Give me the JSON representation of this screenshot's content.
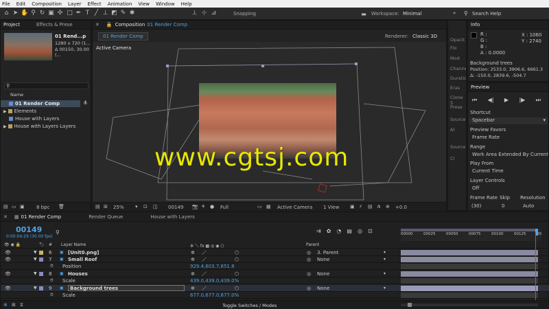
{
  "menu": [
    "File",
    "Edit",
    "Composition",
    "Layer",
    "Effect",
    "Animation",
    "View",
    "Window",
    "Help"
  ],
  "toolbar": {
    "snapping": "Snapping",
    "workspace_label": "Workspace:",
    "workspace_value": "Minimal",
    "search_placeholder": "Search Help"
  },
  "project": {
    "tabs": [
      "Project",
      "Effects & Prese"
    ],
    "thumb_title": "01 Rend...p",
    "thumb_size": "1280 x 720 (1...",
    "thumb_time": "Δ 00150, 30.00 (...",
    "col_name": "Name",
    "items": [
      "01 Render Comp",
      "Elements",
      "House with Layers",
      "House with Layers Layers"
    ],
    "bpc": "8 bpc"
  },
  "composition": {
    "tab_label": "Composition",
    "tab_name": "01 Render Comp",
    "subtab": "01 Render Comp",
    "renderer_label": "Renderer:",
    "renderer_value": "Classic 3D",
    "active_camera": "Active Camera",
    "zoom": "25%",
    "timecode": "00149",
    "resolution": "Full",
    "view_camera": "Active Camera",
    "view_count": "1 View",
    "exposure": "+0.0"
  },
  "middle_strip": [
    "Opacit",
    "Flo",
    "Mod",
    "Channe",
    "Duratio",
    "Eras",
    "Clone S",
    "Prese",
    "Source",
    "Al",
    "Source",
    "Cl"
  ],
  "info": {
    "title": "Info",
    "r": "R :",
    "g": "G :",
    "b": "B :",
    "a": "A : 0.0000",
    "x": "X : 1060",
    "y": "Y : 2740",
    "layer": "Background trees",
    "position": "Position: 2533.0, 3906.6, 6661.3",
    "delta": "Δ: -150.0, 2839.6, -504.7"
  },
  "preview": {
    "title": "Preview",
    "shortcut_label": "Shortcut",
    "shortcut_value": "Spacebar",
    "favors_label": "Preview Favors",
    "favors_value": "Frame Rate",
    "range_label": "Range",
    "range_value": "Work Area Extended By Current Ti",
    "playfrom_label": "Play From",
    "playfrom_value": "Current Time",
    "layer_controls_label": "Layer Controls",
    "layer_controls_value": "Off",
    "framerate_label": "Frame Rate",
    "skip_label": "Skip",
    "resolution_label": "Resolution",
    "framerate_value": "(30)",
    "skip_value": "0",
    "resolution_value": "Auto"
  },
  "timeline": {
    "tabs": [
      "01 Render Comp",
      "Render Queue",
      "House with Layers"
    ],
    "timecode": "00149",
    "fps": "0:00:04:29 (30.00 fps)",
    "col_layer_name": "Layer Name",
    "col_parent": "Parent",
    "ruler": [
      "00000",
      "00025",
      "00050",
      "00075",
      "00100",
      "00125",
      "00"
    ],
    "layers": [
      {
        "num": "6",
        "name": "[Unit0.png]",
        "parent": "3. Parent",
        "color": "#c8b560"
      },
      {
        "num": "7",
        "name": "Small Roof",
        "parent": "None",
        "color": "#8a8ac8"
      },
      {
        "num": "8",
        "name": "Houses",
        "parent": "None",
        "color": "#8a8ac8"
      },
      {
        "num": "9",
        "name": "Background trees",
        "parent": "None",
        "color": "#8a8ac8"
      }
    ],
    "props": [
      {
        "label": "Position",
        "value": "929.4,603.7,651.8"
      },
      {
        "label": "Scale",
        "value": "439.0,439.0,439.0%"
      },
      {
        "label": "Scale",
        "value": "677.0,677.0,677.0%"
      }
    ],
    "toggle_label": "Toggle Switches / Modes"
  },
  "colors": {
    "accent": "#4ea4e8",
    "playhead": "#d04040",
    "ui_bg": "#232323"
  }
}
